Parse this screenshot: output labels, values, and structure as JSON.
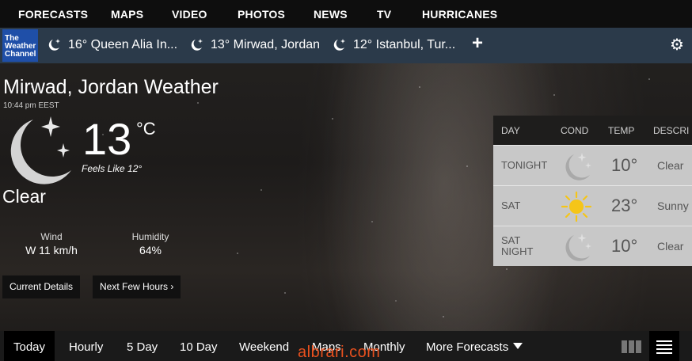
{
  "topnav": {
    "items": [
      "FORECASTS",
      "MAPS",
      "VIDEO",
      "PHOTOS",
      "NEWS",
      "TV",
      "HURRICANES"
    ]
  },
  "locbar": {
    "logo_lines": [
      "The",
      "Weather",
      "Channel"
    ],
    "locations": [
      {
        "label": "16° Queen Alia In...",
        "icon": "moon-stars-icon"
      },
      {
        "label": "13° Mirwad, Jordan",
        "icon": "moon-stars-icon"
      },
      {
        "label": "12° Istanbul, Tur...",
        "icon": "moon-stars-icon"
      }
    ],
    "add_label": "+",
    "settings_icon": "gear-icon"
  },
  "current": {
    "title": "Mirwad, Jordan Weather",
    "time": "10:44 pm EEST",
    "temp": "13",
    "unit": "°C",
    "feels_like": "Feels Like 12°",
    "condition": "Clear",
    "wind_label": "Wind",
    "wind_value": "W 11 km/h",
    "humidity_label": "Humidity",
    "humidity_value": "64%",
    "current_details_label": "Current Details",
    "next_hours_label": "Next Few Hours ›"
  },
  "forecast": {
    "headers": [
      "DAY",
      "COND",
      "TEMP",
      "DESCRI"
    ],
    "rows": [
      {
        "day": "TONIGHT",
        "icon": "moon-stars-icon",
        "temp": "10°",
        "desc": "Clear"
      },
      {
        "day": "SAT",
        "icon": "sun-icon",
        "temp": "23°",
        "desc": "Sunny"
      },
      {
        "day": "SAT NIGHT",
        "day_line1": "SAT",
        "day_line2": "NIGHT",
        "icon": "moon-stars-icon",
        "temp": "10°",
        "desc": "Clear"
      }
    ]
  },
  "tabs": {
    "items": [
      "Today",
      "Hourly",
      "5 Day",
      "10 Day",
      "Weekend",
      "Maps",
      "Monthly",
      "More Forecasts"
    ],
    "active": "Today"
  },
  "watermark": "albrari.com",
  "colors": {
    "topnav_bg": "#0e0e0e",
    "locbar_bg": "#2b3a4a",
    "twc_blue": "#1f4fa8",
    "forecast_row_bg": "#c8c8c8",
    "sun_yellow": "#f5c518",
    "watermark_orange": "#e8501e"
  }
}
